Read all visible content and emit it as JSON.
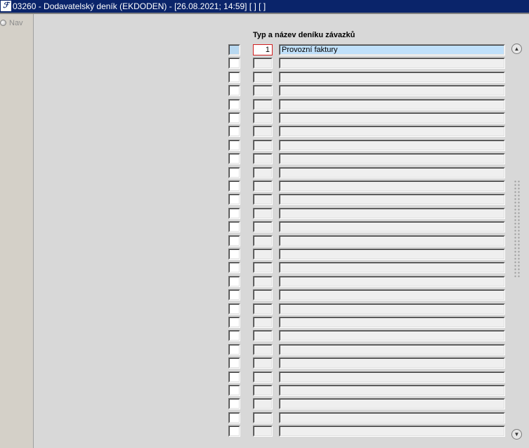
{
  "window": {
    "logo_text": "ℱ",
    "title": "03260 - Dodavatelský deník (EKDODEN) - [26.08.2021; 14:59]  [ ]  [ ]"
  },
  "left_panel": {
    "nav_label": "Nav"
  },
  "grid": {
    "column_header": "Typ a název deníku závazků",
    "rows": [
      {
        "type": "1",
        "name": "Provozní faktury",
        "active": true
      },
      {
        "type": "",
        "name": ""
      },
      {
        "type": "",
        "name": ""
      },
      {
        "type": "",
        "name": ""
      },
      {
        "type": "",
        "name": ""
      },
      {
        "type": "",
        "name": ""
      },
      {
        "type": "",
        "name": ""
      },
      {
        "type": "",
        "name": ""
      },
      {
        "type": "",
        "name": ""
      },
      {
        "type": "",
        "name": ""
      },
      {
        "type": "",
        "name": ""
      },
      {
        "type": "",
        "name": ""
      },
      {
        "type": "",
        "name": ""
      },
      {
        "type": "",
        "name": ""
      },
      {
        "type": "",
        "name": ""
      },
      {
        "type": "",
        "name": ""
      },
      {
        "type": "",
        "name": ""
      },
      {
        "type": "",
        "name": ""
      },
      {
        "type": "",
        "name": ""
      },
      {
        "type": "",
        "name": ""
      },
      {
        "type": "",
        "name": ""
      },
      {
        "type": "",
        "name": ""
      },
      {
        "type": "",
        "name": ""
      },
      {
        "type": "",
        "name": ""
      },
      {
        "type": "",
        "name": ""
      },
      {
        "type": "",
        "name": ""
      },
      {
        "type": "",
        "name": ""
      },
      {
        "type": "",
        "name": ""
      },
      {
        "type": "",
        "name": ""
      }
    ]
  },
  "scrollbar": {
    "up_icon": "scroll-up-arrow-icon",
    "down_icon": "scroll-down-arrow-icon"
  }
}
